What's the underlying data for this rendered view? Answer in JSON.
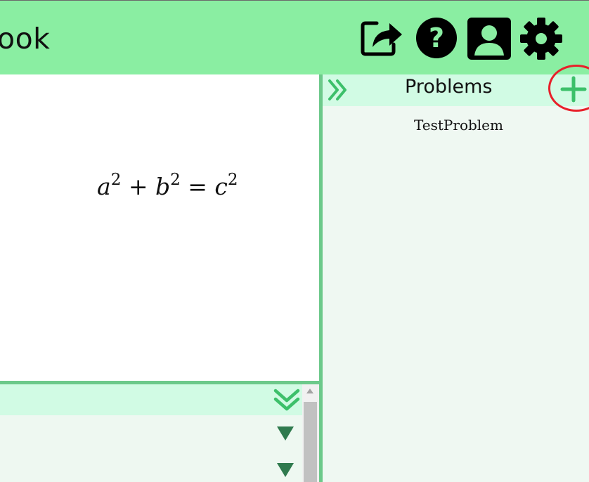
{
  "header": {
    "title_partial": "ook",
    "icons": [
      "share-icon",
      "help-icon",
      "profile-icon",
      "settings-icon"
    ]
  },
  "editor": {
    "math": {
      "a": "a",
      "b": "b",
      "c": "c",
      "exp": "2",
      "plus": "+",
      "equals": "="
    }
  },
  "problems_panel": {
    "title": "Problems",
    "items": [
      {
        "label": "TestProblem"
      }
    ]
  },
  "colors": {
    "header_bg": "#8aeea2",
    "panel_header_bg": "#d1fbe4",
    "panel_body_bg": "#eff8f2",
    "splitter": "#6cc98a",
    "accent_green": "#3cc06a",
    "dark_green": "#2f7a4e",
    "highlight_red": "#e8202a"
  }
}
